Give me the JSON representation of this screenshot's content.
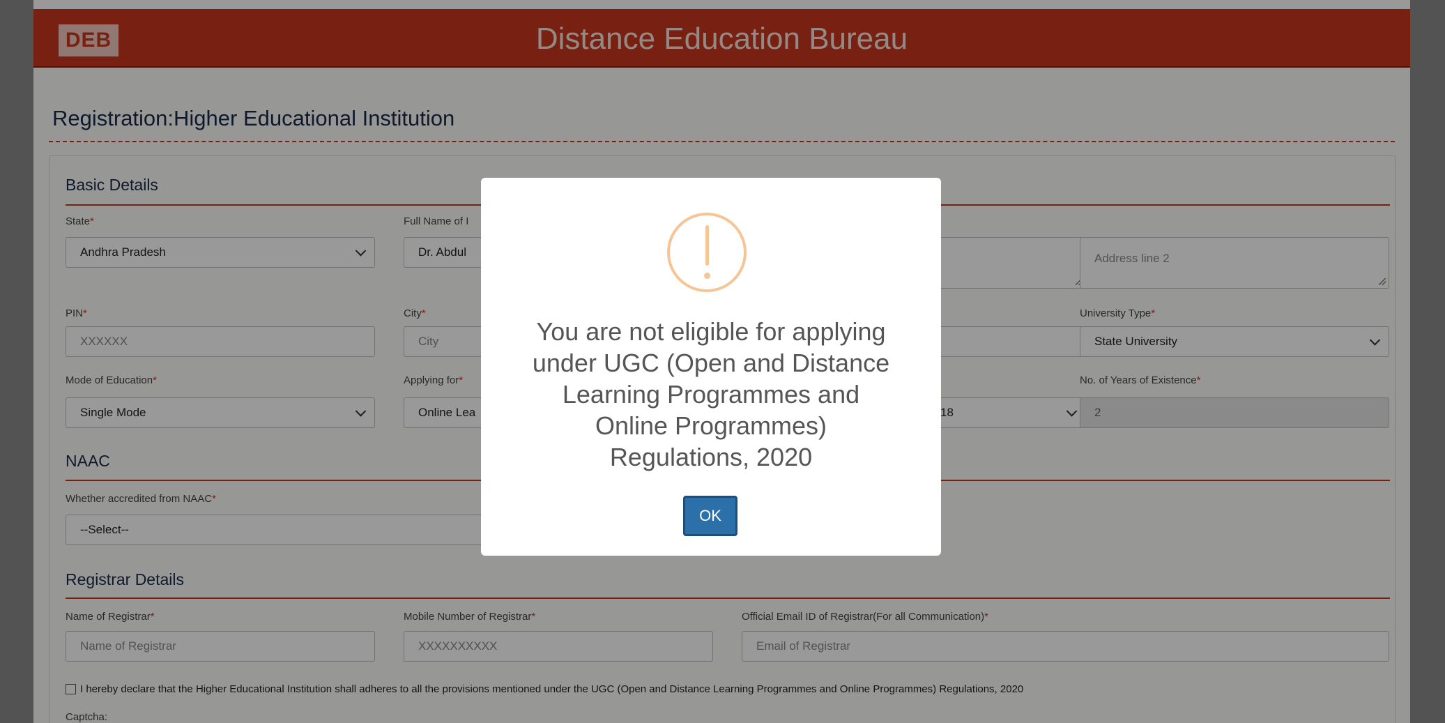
{
  "header": {
    "logo_text": "DEB",
    "title": "Distance Education Bureau"
  },
  "page_title": "Registration:Higher Educational Institution",
  "basic": {
    "title": "Basic Details",
    "state": {
      "label": "State",
      "value": "Andhra Pradesh"
    },
    "full_name": {
      "label": "Full Name of I",
      "value": "Dr. Abdul"
    },
    "address2": {
      "placeholder": "Address line 2"
    },
    "pin": {
      "label": "PIN",
      "placeholder": "XXXXXX"
    },
    "city": {
      "label": "City",
      "placeholder": "City"
    },
    "university_type": {
      "label": "University Type",
      "value": "State University"
    },
    "mode": {
      "label": "Mode of Education",
      "value": "Single Mode"
    },
    "applying_for": {
      "label": "Applying for",
      "value": "Online Lea"
    },
    "year_select": {
      "value": "18"
    },
    "years_existence": {
      "label": "No. of Years of Existence",
      "value": "2"
    }
  },
  "naac": {
    "title": "NAAC",
    "accredited": {
      "label": "Whether accredited from NAAC",
      "value": "--Select--"
    }
  },
  "registrar": {
    "title": "Registrar Details",
    "name": {
      "label": "Name of Registrar",
      "placeholder": "Name of Registrar"
    },
    "mobile": {
      "label": "Mobile Number of Registrar",
      "placeholder": "XXXXXXXXXX"
    },
    "email": {
      "label": "Official Email ID of Registrar(For all Communication)",
      "placeholder": "Email of Registrar"
    }
  },
  "declaration": "I hereby declare that the Higher Educational Institution shall adheres to all the provisions mentioned under the UGC (Open and Distance Learning Programmes and Online Programmes) Regulations, 2020",
  "captcha_label": "Captcha:",
  "required_mark": "*",
  "modal": {
    "icon": "warning-icon",
    "message_lines": [
      "You are not eligible for applying",
      "under UGC (Open and Distance",
      "Learning Programmes and",
      "Online Programmes)",
      "Regulations, 2020"
    ],
    "ok_label": "OK"
  },
  "colors": {
    "brand_red": "#c8381f",
    "ok_button": "#2b70a9",
    "warning": "#f5c596"
  }
}
